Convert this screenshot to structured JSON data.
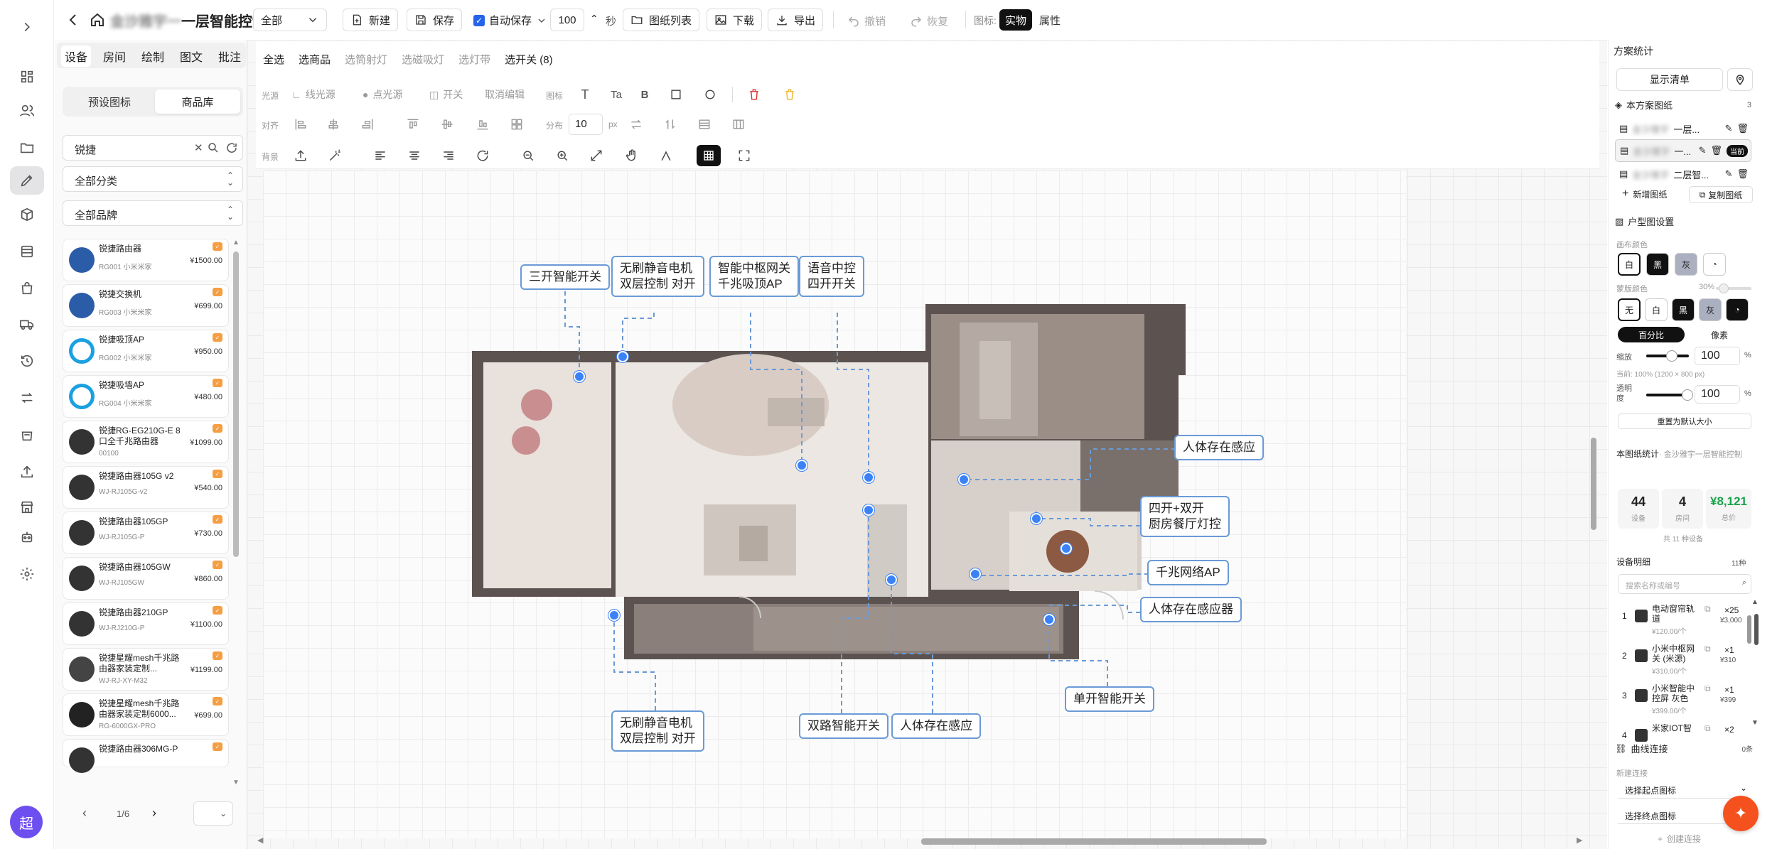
{
  "header": {
    "title_blurred": "金沙雅宇一",
    "title": "一层智能控制",
    "scope": "全部",
    "new": "新建",
    "save": "保存",
    "autosave": "自动保存",
    "autosave_value": "100",
    "autosave_unit": "秒",
    "drawings_list": "图纸列表",
    "download": "下载",
    "export": "导出",
    "undo": "撤销",
    "redo": "恢复",
    "icon_label": "图标:",
    "mode_real": "实物",
    "mode_attr": "属性"
  },
  "left_panel": {
    "tabs": [
      "设备",
      "房间",
      "绘制",
      "图文",
      "批注"
    ],
    "seg": [
      "预设图标",
      "商品库"
    ],
    "search_value": "锐捷",
    "category": "全部分类",
    "brand": "全部品牌",
    "page": "1/6",
    "products": [
      {
        "name": "锐捷路由器",
        "code": "RG001 小米米家",
        "price": "¥1500.00",
        "thumb": "#2b5ca8"
      },
      {
        "name": "锐捷交换机",
        "code": "RG003 小米米家",
        "price": "¥699.00",
        "thumb": "#2b5ca8"
      },
      {
        "name": "锐捷吸顶AP",
        "code": "RG002 小米米家",
        "price": "¥950.00",
        "thumb": "#1ba0e2"
      },
      {
        "name": "锐捷吸墙AP",
        "code": "RG004 小米米家",
        "price": "¥480.00",
        "thumb": "#1ba0e2"
      },
      {
        "name": "锐捷RG-EG210G-E 8口全千兆路由器",
        "code": "00100",
        "price": "¥1099.00",
        "thumb": "#333"
      },
      {
        "name": "锐捷路由器105G v2",
        "code": "WJ-RJ105G-v2",
        "price": "¥540.00",
        "thumb": "#333"
      },
      {
        "name": "锐捷路由器105GP",
        "code": "WJ-RJ105G-P",
        "price": "¥730.00",
        "thumb": "#333"
      },
      {
        "name": "锐捷路由器105GW",
        "code": "WJ-RJ105GW",
        "price": "¥860.00",
        "thumb": "#333"
      },
      {
        "name": "锐捷路由器210GP",
        "code": "WJ-RJ210G-P",
        "price": "¥1100.00",
        "thumb": "#333"
      },
      {
        "name": "锐捷星耀mesh千兆路由器家装定制...",
        "code": "WJ-RJ-XY-M32",
        "price": "¥1199.00",
        "thumb": "#444"
      },
      {
        "name": "锐捷星耀mesh千兆路由器家装定制6000...",
        "code": "RG-6000GX-PRO",
        "price": "¥699.00",
        "thumb": "#222"
      },
      {
        "name": "锐捷路由器306MG-P",
        "code": "",
        "price": "",
        "thumb": "#333"
      }
    ]
  },
  "sub_toolbar": {
    "row1": [
      "全选",
      "选商品",
      "选筒射灯",
      "选磁吸灯",
      "选灯带",
      "选开关 (8)"
    ],
    "light_label": "光源",
    "line_light": "线光源",
    "point_light": "点光源",
    "switch": "开关",
    "cancel_edit": "取消编辑",
    "icon_label": "图标",
    "align_label": "对齐",
    "dist_label": "分布",
    "dist_value": "10",
    "dist_unit": "px",
    "bg_label": "背景"
  },
  "callouts": [
    {
      "text": "三开智能开关"
    },
    {
      "text": "无刷静音电机\n双层控制 对开"
    },
    {
      "text": "智能中枢网关\n千兆吸顶AP"
    },
    {
      "text": "语音中控\n四开开关"
    },
    {
      "text": "人体存在感应"
    },
    {
      "text": "四开+双开\n厨房餐厅灯控"
    },
    {
      "text": "千兆网络AP"
    },
    {
      "text": "人体存在感应器"
    },
    {
      "text": "单开智能开关"
    },
    {
      "text": "人体存在感应"
    },
    {
      "text": "双路智能开关"
    },
    {
      "text": "无刷静音电机\n双层控制 对开"
    }
  ],
  "right_panel": {
    "title": "方案统计",
    "show_list": "显示清单",
    "drawings_title": "本方案图纸",
    "drawings_count": "3",
    "drawings": [
      "一层...",
      "一...",
      "二层智..."
    ],
    "current_badge": "当前",
    "add_drawing": "新增图纸",
    "copy_drawing": "复制图纸",
    "layout_title": "户型图设置",
    "canvas_color": "画布颜色",
    "canvas_opts": [
      "白",
      "黑",
      "灰"
    ],
    "mask_color": "蒙版颜色",
    "mask_percent": "30%",
    "mask_opts": [
      "无",
      "白",
      "黑",
      "灰"
    ],
    "unit_opts": [
      "百分比",
      "像素"
    ],
    "scale_label": "缩放",
    "scale_value": "100",
    "percent": "%",
    "current_info": "当前: 100% (1200 × 800 px)",
    "opacity_label": "透明度",
    "opacity_value": "100",
    "reset": "重置为默认大小",
    "stats_title": "本图纸统计",
    "stats_sub": "· 金沙雅宇一层智能控制",
    "stats": [
      {
        "v": "44",
        "l": "设备"
      },
      {
        "v": "4",
        "l": "房间"
      },
      {
        "v": "¥8,121",
        "l": "总价"
      }
    ],
    "stats_total": "共 11 种设备",
    "detail_title": "设备明细",
    "detail_count": "11种",
    "detail_search": "搜索名称或编号",
    "details": [
      {
        "idx": "1",
        "name": "电动窗帘轨道",
        "qty": "×25",
        "price": "¥120.00/个",
        "total": "¥3,000"
      },
      {
        "idx": "2",
        "name": "小米中枢网关 (米源)",
        "qty": "×1",
        "price": "¥310.00/个",
        "total": "¥310"
      },
      {
        "idx": "3",
        "name": "小米智能中控屏 灰色",
        "qty": "×1",
        "price": "¥399.00/个",
        "total": "¥399"
      },
      {
        "idx": "4",
        "name": "米家IOT智",
        "qty": "×2",
        "price": "",
        "total": ""
      }
    ],
    "curve_title": "曲线连接",
    "curve_count": "0条",
    "new_conn": "新建连接",
    "start_sel": "选择起点图标",
    "end_sel": "选择终点图标",
    "create_conn": "创建连接"
  },
  "user": {
    "avatar": "超"
  }
}
